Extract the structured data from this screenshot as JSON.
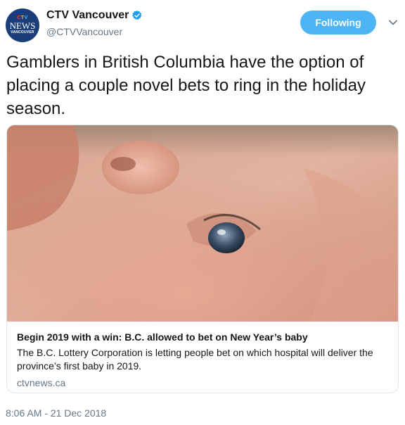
{
  "author": {
    "display_name": "CTV Vancouver",
    "handle": "@CTVVancouver",
    "verified": true,
    "avatar": {
      "brand_letters": [
        "C",
        "T",
        "V"
      ],
      "word": "NEWS",
      "city": "VANCOUVER"
    }
  },
  "follow_button": {
    "label": "Following"
  },
  "tweet": {
    "text": "Gamblers in British Columbia have the option of placing a couple novel bets to ring in the holiday season.",
    "timestamp": "8:06 AM - 21 Dec 2018"
  },
  "card": {
    "title": "Begin 2019 with a win: B.C. allowed to bet on New Year’s baby",
    "description": "The B.C. Lottery Corporation is letting people bet on which hospital will deliver the province’s first baby in 2019.",
    "domain": "ctvnews.ca"
  },
  "colors": {
    "accent": "#1da1f2",
    "text_primary": "#14171a",
    "text_secondary": "#657786",
    "border": "#e1e8ed"
  },
  "icons": {
    "verified": "verified-badge-icon",
    "more": "chevron-down-icon"
  }
}
